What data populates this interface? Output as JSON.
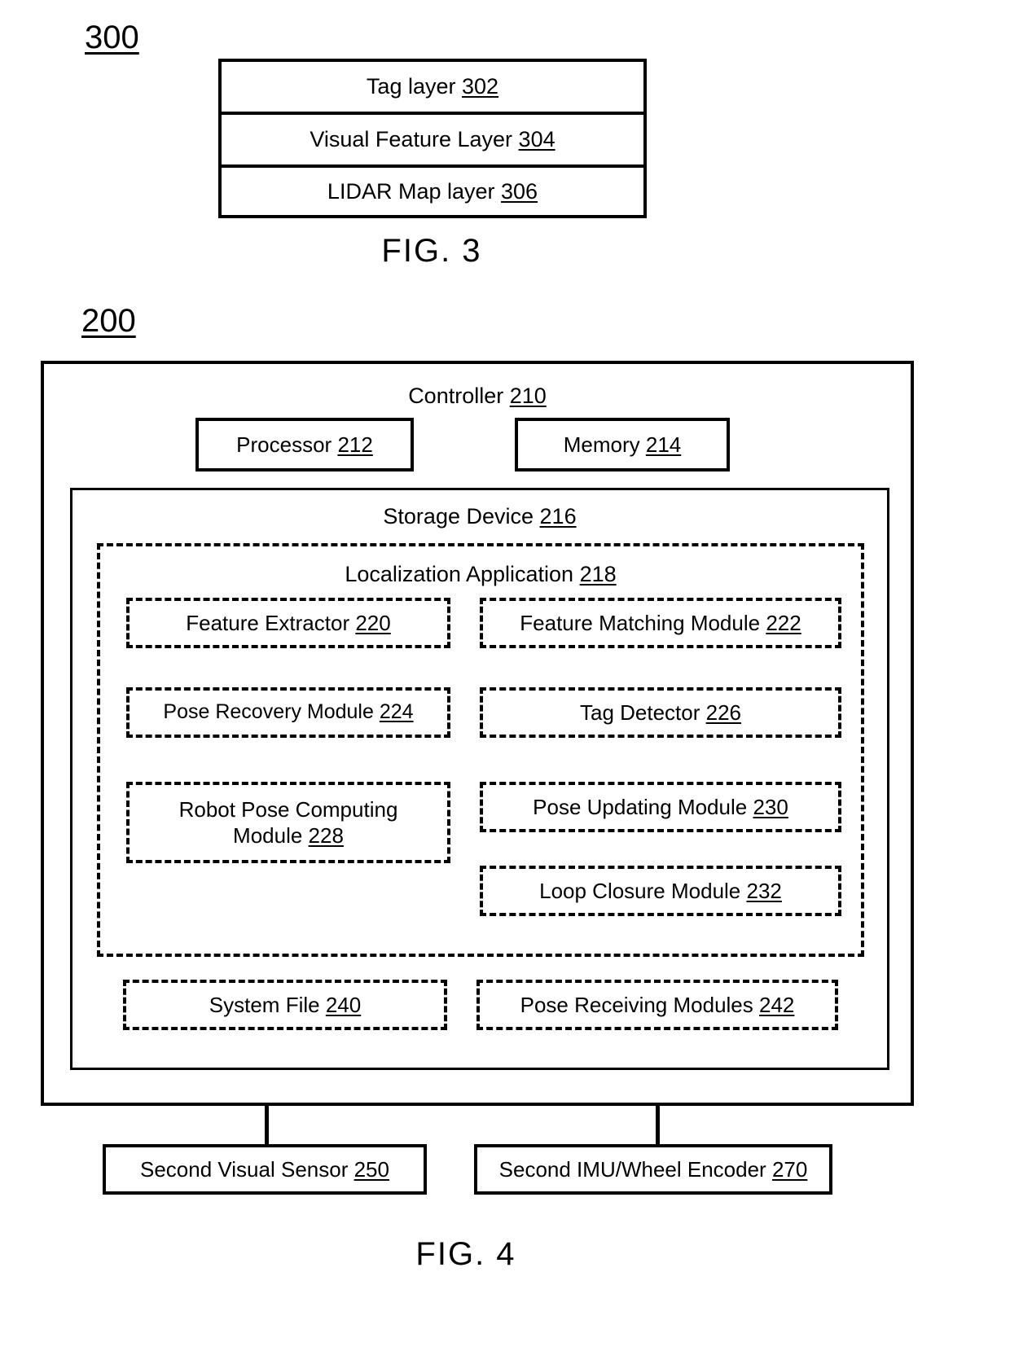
{
  "figures": [
    {
      "id": "fig3",
      "ref_numeral": "300",
      "caption": "FIG. 3",
      "layers": [
        {
          "label": "Tag layer",
          "num": "302"
        },
        {
          "label": "Visual Feature Layer",
          "num": "304"
        },
        {
          "label": "LIDAR Map layer",
          "num": "306"
        }
      ]
    },
    {
      "id": "fig4",
      "ref_numeral": "200",
      "caption": "FIG. 4",
      "controller": {
        "title_label": "Controller",
        "title_num": "210",
        "processor": {
          "label": "Processor",
          "num": "212"
        },
        "memory": {
          "label": "Memory",
          "num": "214"
        },
        "storage_device": {
          "title_label": "Storage Device",
          "title_num": "216",
          "localization_application": {
            "title_label": "Localization Application",
            "title_num": "218",
            "modules": [
              {
                "label": "Feature Extractor",
                "num": "220"
              },
              {
                "label": "Feature Matching Module",
                "num": "222"
              },
              {
                "label": "Pose Recovery Module",
                "num": "224"
              },
              {
                "label": "Tag Detector",
                "num": "226"
              },
              {
                "label": "Robot Pose Computing\nModule",
                "num": "228"
              },
              {
                "label": "Pose Updating Module",
                "num": "230"
              },
              {
                "label": "Loop Closure Module",
                "num": "232"
              }
            ]
          },
          "files": [
            {
              "label": "System File",
              "num": "240"
            },
            {
              "label": "Pose Receiving Modules",
              "num": "242"
            }
          ]
        }
      },
      "sensors": [
        {
          "label": "Second Visual Sensor",
          "num": "250"
        },
        {
          "label": "Second IMU/Wheel Encoder",
          "num": "270"
        }
      ]
    }
  ],
  "colors": {
    "stroke": "#000000",
    "background": "#ffffff"
  }
}
